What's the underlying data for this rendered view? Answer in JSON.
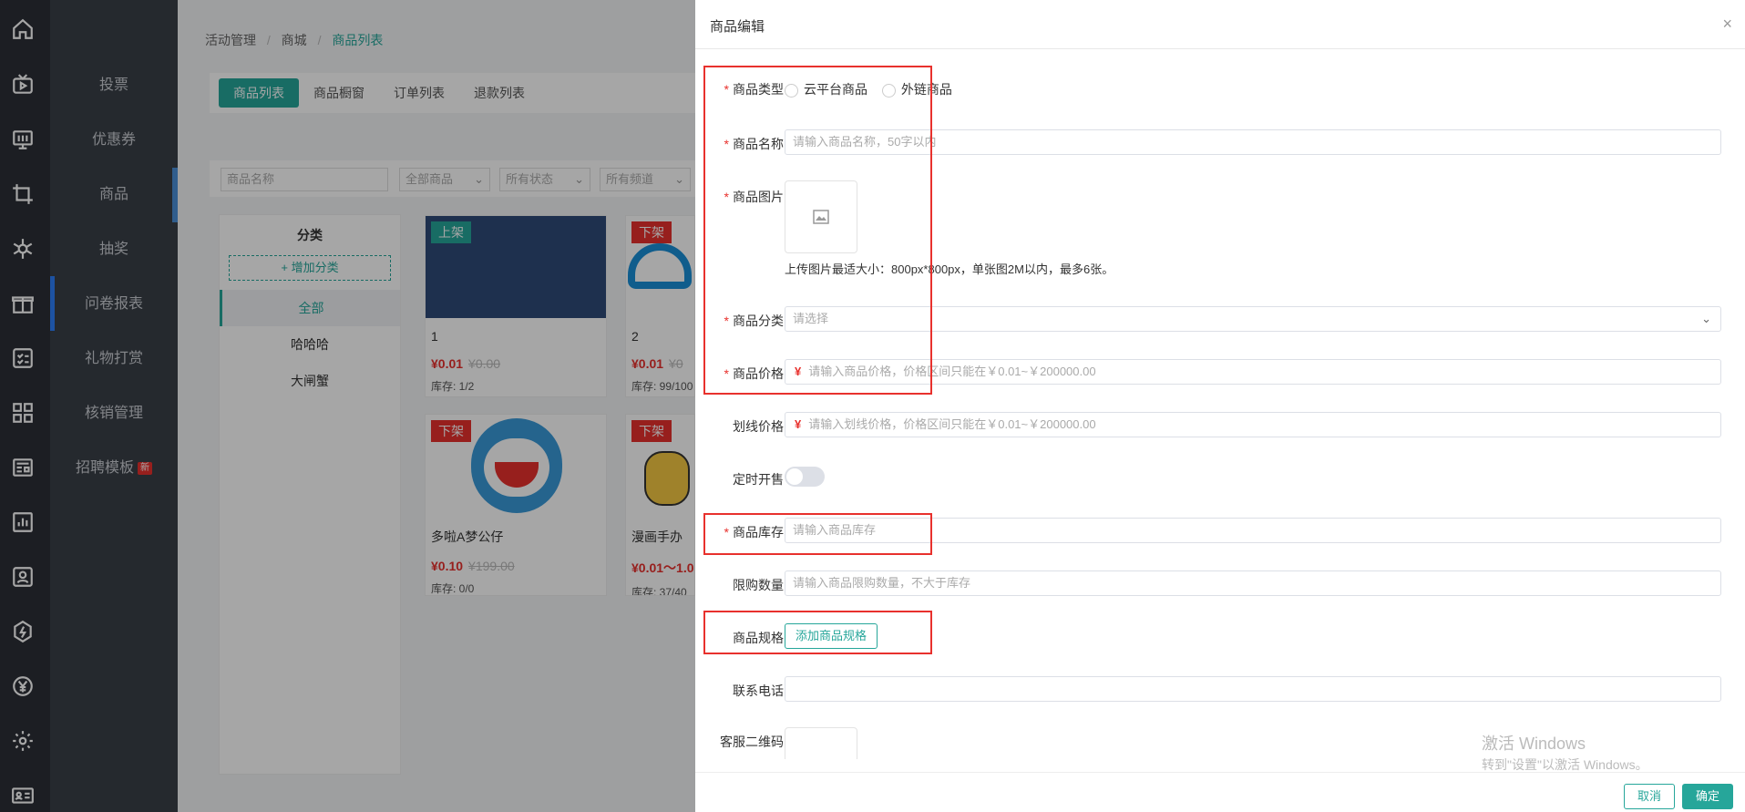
{
  "menu": {
    "items": [
      "投票",
      "优惠券",
      "商品",
      "抽奖",
      "问卷报表",
      "礼物打赏",
      "核销管理",
      "招聘模板"
    ],
    "new_badge": "新"
  },
  "breadcrumb": [
    "活动管理",
    "商城",
    "商品列表"
  ],
  "breadcrumb_sep": "/",
  "tabs": [
    "商品列表",
    "商品橱窗",
    "订单列表",
    "退款列表"
  ],
  "filters": {
    "name_placeholder": "商品名称",
    "all_goods": "全部商品",
    "all_status": "所有状态",
    "all_channels": "所有频道"
  },
  "category": {
    "title": "分类",
    "add": "+ 增加分类",
    "items": [
      "全部",
      "哈哈哈",
      "大闸蟹"
    ]
  },
  "cards": [
    {
      "tag": "上架",
      "name": "1",
      "price": "¥0.01",
      "orig": "¥0.00",
      "stock": "库存: 1/2"
    },
    {
      "tag": "下架",
      "name": "2",
      "price": "¥0.01",
      "orig": "¥0",
      "stock": "库存: 99/100"
    },
    {
      "tag": "下架",
      "name": "多啦A梦公仔",
      "price": "¥0.10",
      "orig": "¥199.00",
      "stock": "库存: 0/0"
    },
    {
      "tag": "下架",
      "name": "漫画手办",
      "price": "¥0.01～1.0",
      "orig": "",
      "stock": "库存: 37/40"
    }
  ],
  "drawer": {
    "title": "商品编辑",
    "close": "×",
    "required_mark": "*",
    "type_label": "商品类型",
    "type_options": [
      "云平台商品",
      "外链商品"
    ],
    "name_label": "商品名称",
    "name_placeholder": "请输入商品名称，50字以内",
    "image_label": "商品图片",
    "image_hint": "上传图片最适大小：800px*800px，单张图2M以内，最多6张。",
    "category_label": "商品分类",
    "category_placeholder": "请选择",
    "price_label": "商品价格",
    "price_symbol": "¥",
    "price_placeholder": "请输入商品价格，价格区间只能在￥0.01~￥200000.00",
    "strike_label": "划线价格",
    "strike_placeholder": "请输入划线价格，价格区间只能在￥0.01~￥200000.00",
    "timed_label": "定时开售",
    "stock_label": "商品库存",
    "stock_placeholder": "请输入商品库存",
    "limit_label": "限购数量",
    "limit_placeholder": "请输入商品限购数量，不大于库存",
    "spec_label": "商品规格",
    "spec_button": "添加商品规格",
    "phone_label": "联系电话",
    "qr_label": "客服二维码",
    "cancel": "取消",
    "confirm": "确定"
  },
  "watermark": {
    "line1": "激活 Windows",
    "line2": "转到\"设置\"以激活 Windows。"
  }
}
